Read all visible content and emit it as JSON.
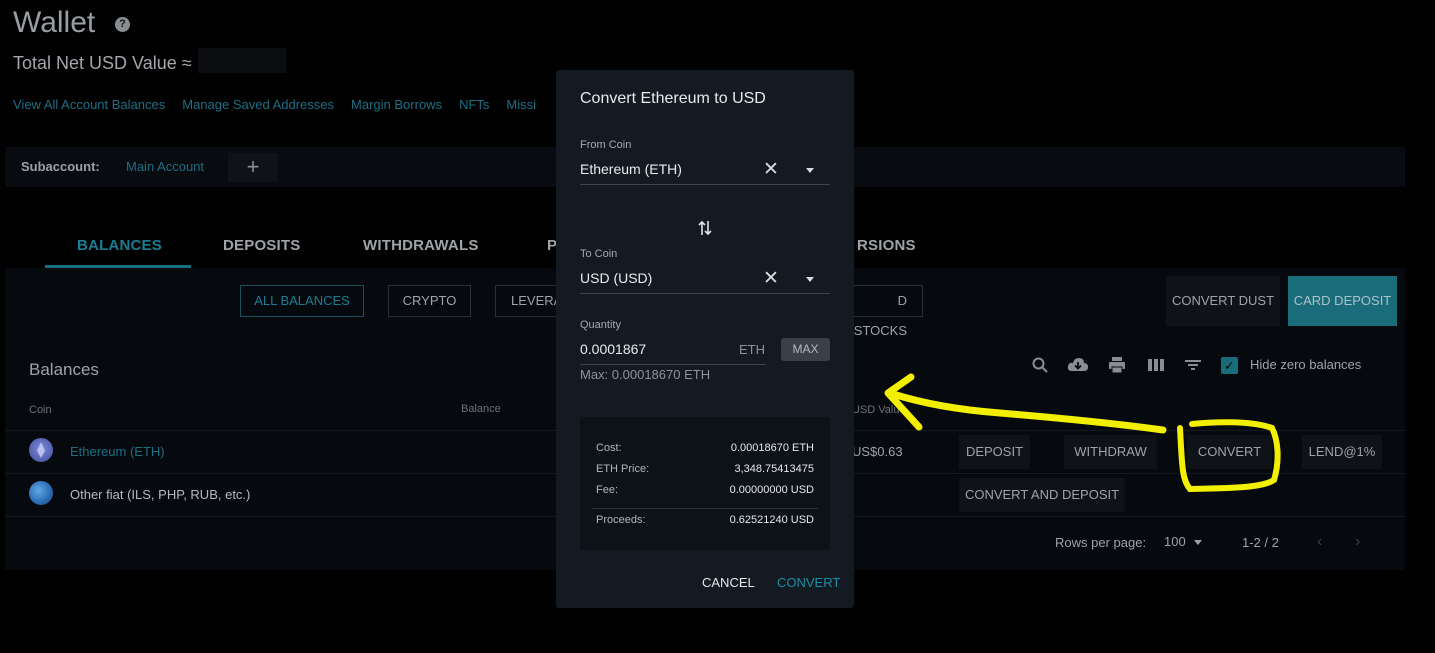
{
  "header": {
    "title": "Wallet",
    "help_glyph": "?",
    "net_value_label": "Total Net USD Value ≈"
  },
  "links": [
    "View All Account Balances",
    "Manage Saved Addresses",
    "Margin Borrows",
    "NFTs",
    "Missi"
  ],
  "subaccount": {
    "label": "Subaccount:",
    "current": "Main Account",
    "add_glyph": "+"
  },
  "tabs": [
    "BALANCES",
    "DEPOSITS",
    "WITHDRAWALS",
    "P",
    "RSIONS"
  ],
  "filters": [
    "ALL BALANCES",
    "CRYPTO",
    "LEVERA",
    "D STOCKS"
  ],
  "actions": {
    "convert_dust": "CONVERT DUST",
    "card_deposit": "CARD DEPOSIT"
  },
  "balances": {
    "title": "Balances",
    "hide_zero_label": "Hide zero balances",
    "hide_zero_checked": true,
    "columns": {
      "coin": "Coin",
      "balance": "Balance",
      "usd_value": "USD Value"
    },
    "rows": [
      {
        "name": "Ethereum (ETH)",
        "usd_value": "US$0.63",
        "buttons": [
          "DEPOSIT",
          "WITHDRAW",
          "CONVERT",
          "LEND@1%"
        ]
      },
      {
        "name": "Other fiat (ILS, PHP, RUB, etc.)",
        "buttons": [
          "CONVERT AND DEPOSIT"
        ]
      }
    ],
    "footer": {
      "rows_per_page_label": "Rows per page:",
      "rows_per_page_value": "100",
      "range": "1-2 / 2"
    }
  },
  "modal": {
    "title": "Convert Ethereum to USD",
    "from_label": "From Coin",
    "from_value": "Ethereum (ETH)",
    "to_label": "To Coin",
    "to_value": "USD (USD)",
    "quantity_label": "Quantity",
    "quantity_value": "0.0001867",
    "quantity_unit": "ETH",
    "max_label": "MAX",
    "max_text": "Max: 0.00018670 ETH",
    "summary": [
      {
        "key": "Cost:",
        "value": "0.00018670 ETH"
      },
      {
        "key": "ETH Price:",
        "value": "3,348.75413475"
      },
      {
        "key": "Fee:",
        "value": "0.00000000 USD"
      },
      {
        "key": "Proceeds:",
        "value": "0.62521240 USD"
      }
    ],
    "cancel_label": "CANCEL",
    "convert_label": "CONVERT"
  },
  "colors": {
    "accent": "#1c7d92",
    "annotation": "#f2f000",
    "modal_bg": "#131a22"
  }
}
